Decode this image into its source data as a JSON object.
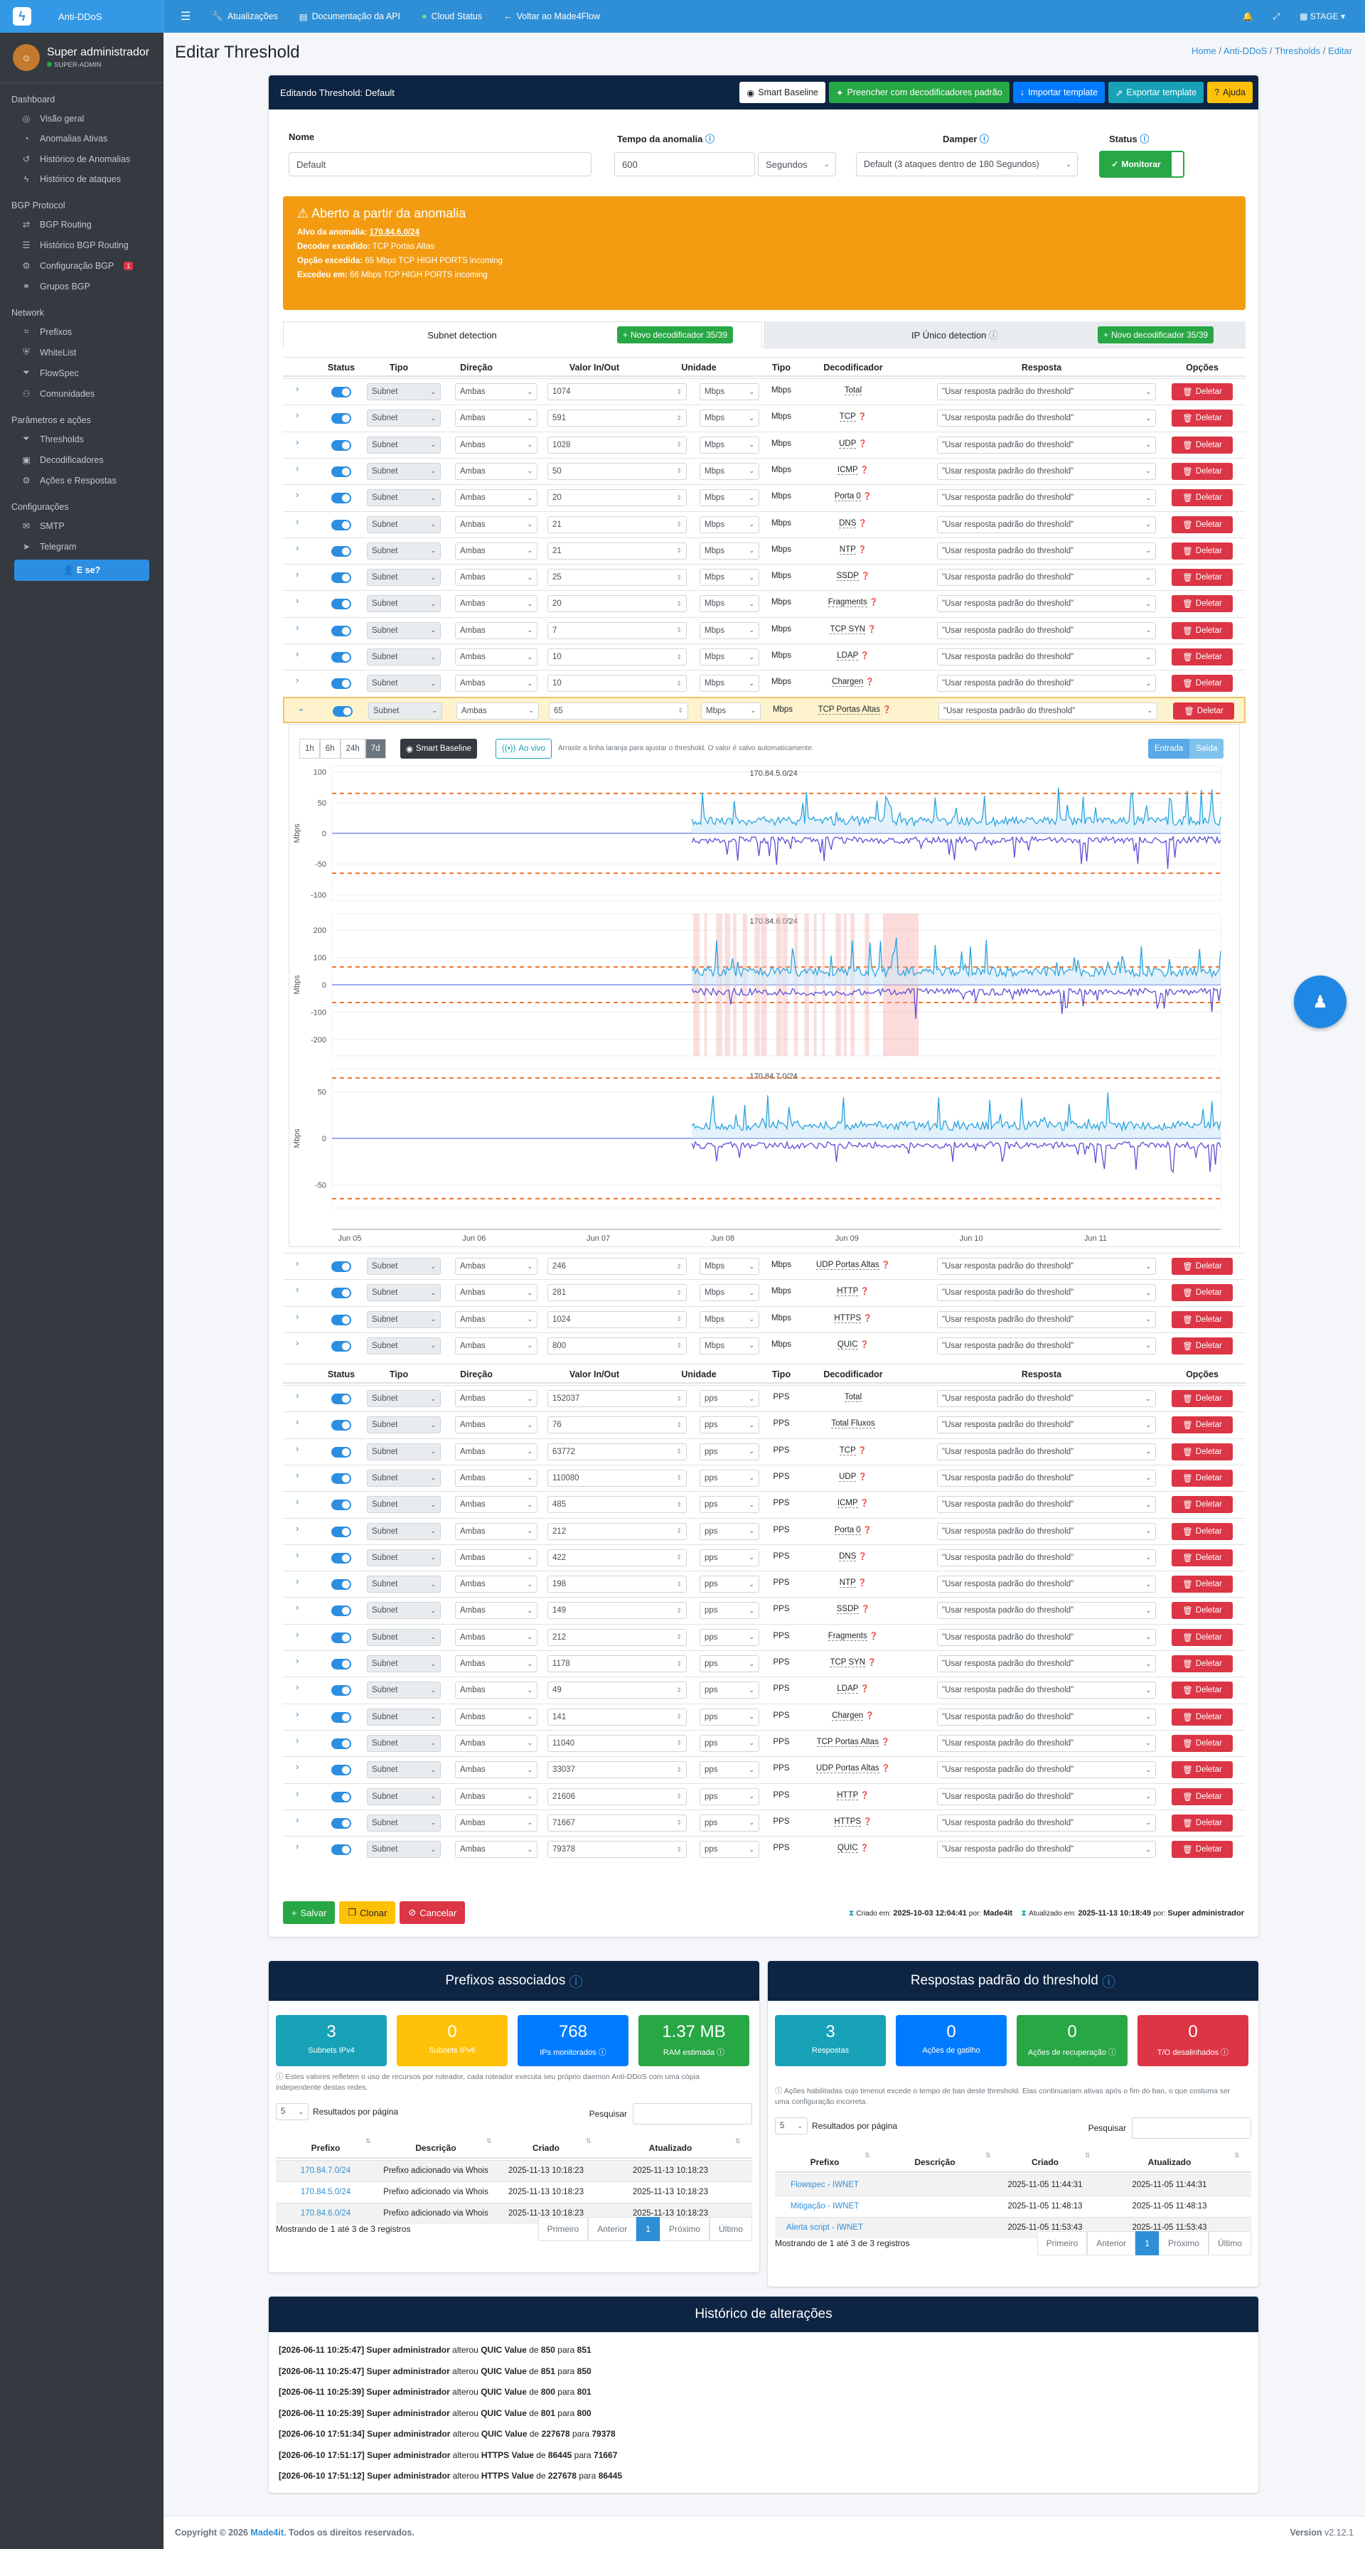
{
  "topbar": {
    "brand": "Anti-DDoS",
    "links": [
      "Atualizações",
      "Documentação da API",
      "Cloud Status",
      "Voltar ao Made4Flow"
    ],
    "stage": "STAGE"
  },
  "sidebar": {
    "user_name": "Super administrador",
    "user_role": "SUPER-ADMIN",
    "sections": [
      {
        "title": "Dashboard",
        "items": [
          {
            "label": "Visão geral"
          },
          {
            "label": "Anomalias Ativas"
          },
          {
            "label": "Histórico de Anomalias"
          },
          {
            "label": "Histórico de ataques"
          }
        ]
      },
      {
        "title": "BGP Protocol",
        "items": [
          {
            "label": "BGP Routing"
          },
          {
            "label": "Histórico BGP Routing"
          },
          {
            "label": "Configuração BGP",
            "badge": "1"
          },
          {
            "label": "Grupos BGP"
          }
        ]
      },
      {
        "title": "Network",
        "items": [
          {
            "label": "Prefixos"
          },
          {
            "label": "WhiteList"
          },
          {
            "label": "FlowSpec"
          },
          {
            "label": "Comunidades"
          }
        ]
      },
      {
        "title": "Parâmetros e ações",
        "items": [
          {
            "label": "Thresholds"
          },
          {
            "label": "Decodificadores"
          },
          {
            "label": "Ações e Respostas"
          }
        ]
      },
      {
        "title": "Configurações",
        "items": [
          {
            "label": "SMTP"
          },
          {
            "label": "Telegram"
          }
        ]
      }
    ],
    "sair": "E se?"
  },
  "page": {
    "title": "Editar Threshold",
    "breadcrumb": [
      "Home",
      "Anti-DDoS",
      "Thresholds",
      "Editar"
    ]
  },
  "editor": {
    "header": "Editando Threshold: Default",
    "buttons": [
      "Smart Baseline",
      "Preencher com decodificadores padrão",
      "Importar template",
      "Exportar template",
      "Ajuda"
    ],
    "nome_label": "Nome",
    "nome_value": "Default",
    "tempo_label": "Tempo da anomalia",
    "tempo_value": "600",
    "tempo_unit": "Segundos",
    "damper_label": "Damper",
    "damper_value": "Default (3 ataques dentro de 180 Segundos)",
    "status_label": "Status",
    "status_value": "Monitorar"
  },
  "alert": {
    "title": "Aberto a partir da anomalia",
    "alvo_label": "Alvo da anomalia:",
    "alvo_value": "170.84.6.0/24",
    "dec_label": "Decoder excedido:",
    "dec_value": "TCP Portas Altas",
    "opt_label": "Opção excedida:",
    "opt_value": "65 Mbps TCP HIGH PORTS incoming",
    "exc_label": "Excedeu em:",
    "exc_value": "66 Mbps TCP HIGH PORTS incoming"
  },
  "tabs": {
    "subnet": "Subnet detection",
    "subnet_btn": "Novo decodificador 35/39",
    "ip": "IP Único detection",
    "ip_btn": "Novo decodificador 35/39"
  },
  "table_headers": {
    "status": "Status",
    "tipo": "Tipo",
    "direcao": "Direção",
    "valor": "Valor In/Out",
    "unidade": "Unidade",
    "tipo2": "Tipo",
    "decodificador": "Decodificador",
    "resposta": "Resposta",
    "opcoes": "Opções"
  },
  "common": {
    "subnet": "Subnet",
    "ambas": "Ambas",
    "resposta": "\"Usar resposta padrão do threshold\"",
    "deletar": "Deletar"
  },
  "mbps_rows": [
    {
      "value": "1074",
      "dec": "Total"
    },
    {
      "value": "591",
      "dec": "TCP"
    },
    {
      "value": "1028",
      "dec": "UDP"
    },
    {
      "value": "50",
      "dec": "ICMP"
    },
    {
      "value": "20",
      "dec": "Porta 0"
    },
    {
      "value": "21",
      "dec": "DNS"
    },
    {
      "value": "21",
      "dec": "NTP"
    },
    {
      "value": "25",
      "dec": "SSDP"
    },
    {
      "value": "20",
      "dec": "Fragments"
    },
    {
      "value": "7",
      "dec": "TCP SYN"
    },
    {
      "value": "10",
      "dec": "LDAP"
    },
    {
      "value": "10",
      "dec": "Chargen"
    },
    {
      "value": "65",
      "dec": "TCP Portas Altas"
    }
  ],
  "mbps_rows2": [
    {
      "value": "246",
      "dec": "UDP Portas Altas"
    },
    {
      "value": "281",
      "dec": "HTTP"
    },
    {
      "value": "1024",
      "dec": "HTTPS"
    },
    {
      "value": "800",
      "dec": "QUIC"
    }
  ],
  "pps_rows": [
    {
      "value": "152037",
      "dec": "Total"
    },
    {
      "value": "76",
      "dec": "Total Fluxos"
    },
    {
      "value": "63772",
      "dec": "TCP"
    },
    {
      "value": "110080",
      "dec": "UDP"
    },
    {
      "value": "485",
      "dec": "ICMP"
    },
    {
      "value": "212",
      "dec": "Porta 0"
    },
    {
      "value": "422",
      "dec": "DNS"
    },
    {
      "value": "198",
      "dec": "NTP"
    },
    {
      "value": "149",
      "dec": "SSDP"
    },
    {
      "value": "212",
      "dec": "Fragments"
    },
    {
      "value": "1178",
      "dec": "TCP SYN"
    },
    {
      "value": "49",
      "dec": "LDAP"
    },
    {
      "value": "141",
      "dec": "Chargen"
    },
    {
      "value": "11040",
      "dec": "TCP Portas Altas"
    },
    {
      "value": "33037",
      "dec": "UDP Portas Altas"
    },
    {
      "value": "21606",
      "dec": "HTTP"
    },
    {
      "value": "71667",
      "dec": "HTTPS"
    },
    {
      "value": "79378",
      "dec": "QUIC"
    }
  ],
  "units": {
    "mbps": "Mbps",
    "pps": "pps",
    "mbps_t": "Mbps",
    "pps_t": "PPS"
  },
  "chart_panel": {
    "ranges": [
      "1h",
      "6h",
      "24h",
      "7d"
    ],
    "active_range": "7d",
    "smart": "Smart Baseline",
    "live": "Ao vivo",
    "hint": "Arraste a linha laranja para ajustar o threshold. O valor é salvo automaticamente.",
    "entrada": "Entrada",
    "saida": "Saída"
  },
  "chart_data": {
    "type": "line",
    "xlabel": "",
    "ylabel": "Mbps",
    "x_ticks": [
      "Jun 05",
      "Jun 06",
      "Jun 07",
      "Jun 08",
      "Jun 09",
      "Jun 10",
      "Jun 11"
    ],
    "panels": [
      {
        "title": "170.84.5.0/24",
        "ylim": [
          -110,
          110
        ],
        "yticks": [
          "100",
          "50",
          "0",
          "-50",
          "-100"
        ],
        "threshold": 65
      },
      {
        "title": "170.84.6.0/24",
        "ylim": [
          -260,
          260
        ],
        "yticks": [
          "200",
          "100",
          "0",
          "-100",
          "-200"
        ],
        "threshold": 65
      },
      {
        "title": "170.84.7.0/24",
        "ylim": [
          -75,
          75
        ],
        "yticks": [
          "50",
          "0",
          "-50"
        ],
        "threshold": 65
      }
    ]
  },
  "form_footer": {
    "salvar": "Salvar",
    "clonar": "Clonar",
    "cancelar": "Cancelar",
    "criado_label": "Criado em:",
    "criado_value": "2025-10-03 12:04:41",
    "criado_por_label": "por:",
    "criado_por": "Made4it",
    "atual_label": "Atualizado em:",
    "atual_value": "2025-11-13 10:18:49",
    "atual_por_label": "por:",
    "atual_por": "Super administrador"
  },
  "prefixos": {
    "title": "Prefixos associados",
    "stats": [
      {
        "value": "3",
        "label": "Subnets IPv4"
      },
      {
        "value": "0",
        "label": "Subnets IPv6"
      },
      {
        "value": "768",
        "label": "IPs monitorados"
      },
      {
        "value": "1.37 MB",
        "label": "RAM estimada"
      }
    ],
    "note": "Estes valores refletem o uso de recursos por roteador, cada roteador executa seu próprio daemon Anti-DDoS com uma cópia independente destas redes.",
    "page_size": "5",
    "per_page": "Resultados por página",
    "search": "Pesquisar",
    "headers": [
      "Prefixo",
      "Descrição",
      "Criado",
      "Atualizado"
    ],
    "rows": [
      [
        "170.84.7.0/24",
        "Prefixo adicionado via Whois",
        "2025-11-13 10:18:23",
        "2025-11-13 10:18:23"
      ],
      [
        "170.84.5.0/24",
        "Prefixo adicionado via Whois",
        "2025-11-13 10:18:23",
        "2025-11-13 10:18:23"
      ],
      [
        "170.84.6.0/24",
        "Prefixo adicionado via Whois",
        "2025-11-13 10:18:23",
        "2025-11-13 10:18:23"
      ]
    ],
    "info": "Mostrando de 1 até 3 de 3 registros",
    "pagination": [
      "Primeiro",
      "Anterior",
      "1",
      "Próximo",
      "Último"
    ]
  },
  "respostas": {
    "title": "Respostas padrão do threshold",
    "stats": [
      {
        "value": "3",
        "label": "Respostas"
      },
      {
        "value": "0",
        "label": "Ações de gatilho"
      },
      {
        "value": "0",
        "label": "Ações de recuperação"
      },
      {
        "value": "0",
        "label": "T/O desalinhados"
      }
    ],
    "note": "Ações habilitadas cujo timeout excede o tempo de ban deste threshold. Elas continuariam ativas após o fim do ban, o que costuma ser uma configuração incorreta.",
    "page_size": "5",
    "per_page": "Resultados por página",
    "search": "Pesquisar",
    "headers": [
      "Prefixo",
      "Descrição",
      "Criado",
      "Atualizado"
    ],
    "rows": [
      [
        "Flowspec - IWNET",
        "",
        "2025-11-05 11:44:31",
        "2025-11-05 11:44:31"
      ],
      [
        "Mitigação - IWNET",
        "",
        "2025-11-05 11:48:13",
        "2025-11-05 11:48:13"
      ],
      [
        "Alerta script - IWNET",
        "",
        "2025-11-05 11:53:43",
        "2025-11-05 11:53:43"
      ]
    ],
    "info": "Mostrando de 1 até 3 de 3 registros",
    "pagination": [
      "Primeiro",
      "Anterior",
      "1",
      "Próximo",
      "Último"
    ]
  },
  "historico": {
    "title": "Histórico de alterações",
    "entries": [
      {
        "ts": "[2026-06-11 10:25:47]",
        "user": "Super administrador",
        "field": "QUIC Value",
        "from": "850",
        "to": "851"
      },
      {
        "ts": "[2026-06-11 10:25:47]",
        "user": "Super administrador",
        "field": "QUIC Value",
        "from": "851",
        "to": "850"
      },
      {
        "ts": "[2026-06-11 10:25:39]",
        "user": "Super administrador",
        "field": "QUIC Value",
        "from": "800",
        "to": "801"
      },
      {
        "ts": "[2026-06-11 10:25:39]",
        "user": "Super administrador",
        "field": "QUIC Value",
        "from": "801",
        "to": "800"
      },
      {
        "ts": "[2026-06-10 17:51:34]",
        "user": "Super administrador",
        "field": "QUIC Value",
        "from": "227678",
        "to": "79378"
      },
      {
        "ts": "[2026-06-10 17:51:17]",
        "user": "Super administrador",
        "field": "HTTPS Value",
        "from": "86445",
        "to": "71667"
      },
      {
        "ts": "[2026-06-10 17:51:12]",
        "user": "Super administrador",
        "field": "HTTPS Value",
        "from": "227678",
        "to": "86445"
      }
    ],
    "verb": "alterou",
    "de": "de",
    "para": "para"
  },
  "footer": {
    "copyright": "Copyright © 2026",
    "brand": "Made4it.",
    "rights": "Todos os direitos reservados.",
    "version": "Version",
    "version_num": "v2.12.1"
  }
}
